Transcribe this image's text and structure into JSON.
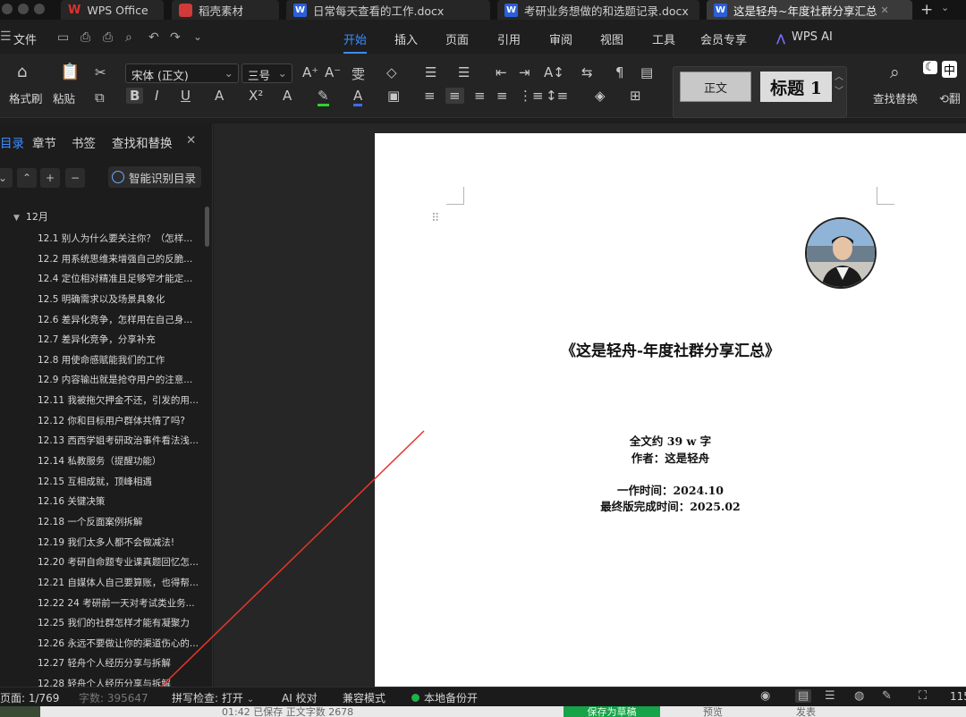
{
  "tabs": [
    {
      "label": "WPS Office"
    },
    {
      "label": "稻壳素材"
    },
    {
      "label": "日常每天查看的工作.docx"
    },
    {
      "label": "考研业务想做的和选题记录.docx"
    },
    {
      "label": "这是轻舟~年度社群分享汇总"
    }
  ],
  "menu": {
    "file": "文件",
    "items": [
      "开始",
      "插入",
      "页面",
      "引用",
      "审阅",
      "视图",
      "工具",
      "会员专享",
      "WPS AI"
    ]
  },
  "ribbon": {
    "format_painter": "格式刷",
    "paste": "粘贴",
    "font_name": "宋体 (正文)",
    "font_size": "三号",
    "style_normal": "正文",
    "style_heading": "标题 1",
    "find_replace": "查找替换"
  },
  "sidebar": {
    "tabs": [
      "目录",
      "章节",
      "书签",
      "查找和替换"
    ],
    "smart_toc": "智能识别目录",
    "group": "12月",
    "items": [
      "12.1 别人为什么要关注你？（怎样...",
      "12.2 用系统思维来增强自己的反脆...",
      "12.4 定位相对精准且足够窄才能定...",
      "12.5 明确需求以及场景具象化",
      "12.6 差异化竞争，怎样用在自己身...",
      "12.7 差异化竞争，分享补充",
      "12.8 用使命感赋能我们的工作",
      "12.9 内容输出就是抢夺用户的注意...",
      "12.11 我被拖欠押金不还，引发的用...",
      "12.12 你和目标用户群体共情了吗?",
      "12.13 西西学姐考研政治事件看法浅...",
      "12.14 私教服务（提醒功能）",
      "12.15 互相成就，顶峰相遇",
      "12.16 关键决策",
      "12.18 一个反面案例拆解",
      "12.19 我们太多人都不会做减法!",
      "12.20 考研自命题专业课真题回忆怎...",
      "12.21 自媒体人自己要算账，也得帮...",
      "12.22 24 考研前一天对考试类业务...",
      "12.25 我们的社群怎样才能有凝聚力",
      "12.26 永远不要做让你的渠道伤心的...",
      "12.27 轻舟个人经历分享与拆解",
      "12.28 轻舟个人经历分享与拆解"
    ]
  },
  "document": {
    "title": "《这是轻舟-年度社群分享汇总》",
    "word_count": "全文约 39 w 字",
    "author": "作者：这是轻舟",
    "first_time": "一作时间：2024.10",
    "final_time": "最终版完成时间：2025.02"
  },
  "status": {
    "page": "页面: 1/769",
    "words": "字数: 395647",
    "spell": "拼写检查: 打开",
    "ai_proof": "AI 校对",
    "compat": "兼容模式",
    "backup": "本地备份开",
    "zoom": "115"
  },
  "bottom_strip": {
    "saved": "01:42  已保存    正文字数  2678",
    "save_draft": "保存为草稿",
    "preview": "预览",
    "publish": "发表"
  },
  "colors": {
    "accent": "#3c8cff",
    "annotation": "#e8352b",
    "backup_dot": "#21b04b"
  }
}
